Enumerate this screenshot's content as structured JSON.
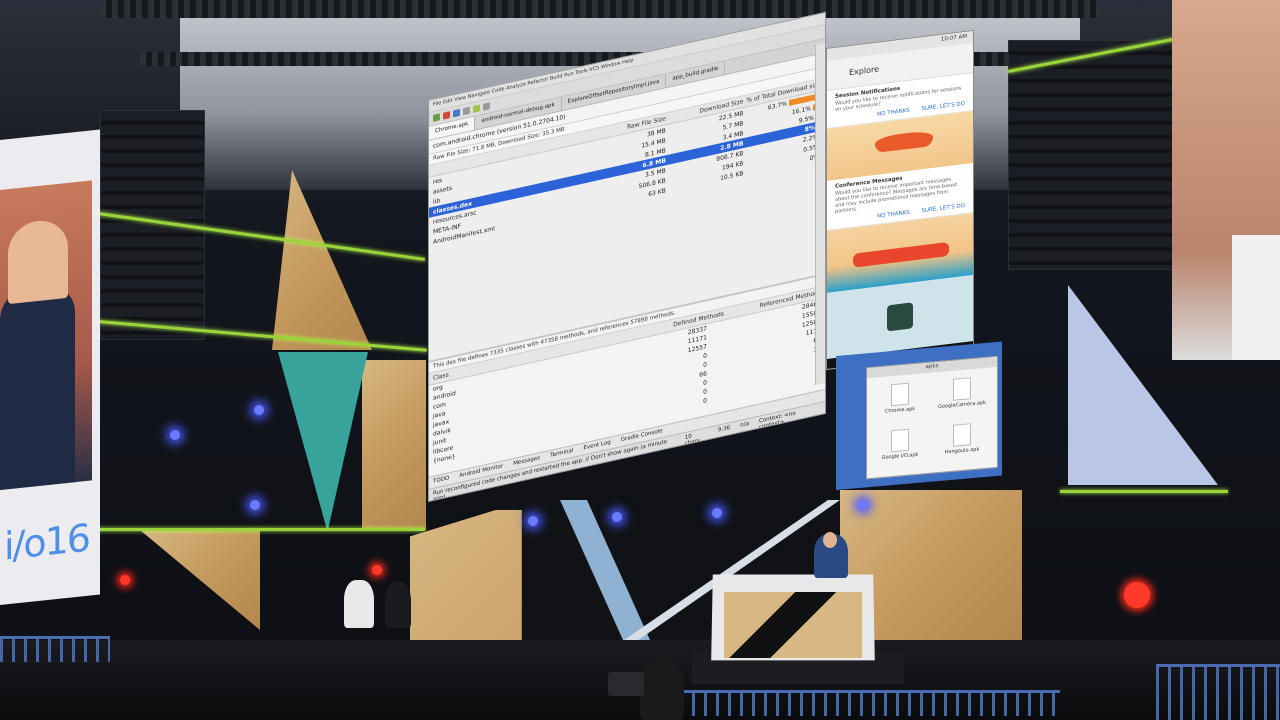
{
  "scene": {
    "description_label": "Keynote stage photo with projected Android Studio APK Analyzer"
  },
  "ide": {
    "menu": "File  Edit  View  Navigate  Code  Analyze  Refactor  Build  Run  Tools  VCS  Window  Help",
    "tabs": [
      "Chrome.apk",
      "android-normal-debug.apk",
      "ExploreOffsetRepositoryImpl.java",
      "app_build.gradle"
    ],
    "header_path": "com.android.chrome (version 51.0.2704.10)",
    "header_size": "Raw File Size: 71.8 MB, Download Size: 35.3 MB",
    "columns": {
      "file": "",
      "raw": "Raw File Size",
      "download": "Download Size",
      "percent": "% of Total Download size"
    },
    "files": [
      {
        "name": "res",
        "raw": "38 MB",
        "download": "22.5 MB",
        "percent": "63.7%",
        "bar": 64
      },
      {
        "name": "assets",
        "raw": "15.4 MB",
        "download": "5.7 MB",
        "percent": "16.1%",
        "bar": 16
      },
      {
        "name": "lib",
        "raw": "8.1 MB",
        "download": "3.4 MB",
        "percent": "9.5%",
        "bar": 10
      },
      {
        "name": "classes.dex",
        "raw": "6.8 MB",
        "download": "2.8 MB",
        "percent": "8%",
        "bar": 8
      },
      {
        "name": "resources.arsc",
        "raw": "3.5 MB",
        "download": "808.7 KB",
        "percent": "2.2%",
        "bar": 2
      },
      {
        "name": "META-INF",
        "raw": "506.8 KB",
        "download": "194 KB",
        "percent": "0.5%",
        "bar": 1
      },
      {
        "name": "AndroidManifest.xml",
        "raw": "63 KB",
        "download": "10.5 KB",
        "percent": "0%",
        "bar": 0
      }
    ],
    "dex_info": "This dex file defines 7335 classes with 47358 methods, and references 57898 methods.",
    "dex_columns": {
      "name": "Class",
      "defined": "Defined Methods",
      "referenced": "Referenced Methods"
    },
    "dex_rows": [
      {
        "name": "org",
        "defined": "28337",
        "referenced": "28467"
      },
      {
        "name": "android",
        "defined": "11171",
        "referenced": "15581"
      },
      {
        "name": "com",
        "defined": "12557",
        "referenced": "12567"
      },
      {
        "name": "java",
        "defined": "0",
        "referenced": "1175"
      },
      {
        "name": "javax",
        "defined": "0",
        "referenced": "66"
      },
      {
        "name": "dalvik",
        "defined": "66",
        "referenced": "32"
      },
      {
        "name": "junit",
        "defined": "0",
        "referenced": "3"
      },
      {
        "name": "libcore",
        "defined": "0",
        "referenced": "1"
      },
      {
        "name": "{none}",
        "defined": "0",
        "referenced": "1"
      }
    ],
    "bottombar": [
      "TODO",
      "Android Monitor",
      "Messages",
      "Terminal",
      "Event Log",
      "Gradle Console"
    ],
    "status": [
      "Run reconfigured code changes and restarted the app. // Don't show again (a minute ago)",
      "10 chars",
      "9:36",
      "n/a",
      "Context: <no context>"
    ],
    "side_labels": [
      "Gradle",
      "Android Model"
    ]
  },
  "phone": {
    "status_time": "10:07 AM",
    "app_title": "Explore",
    "card1_title": "Session Notifications",
    "card1_body": "Would you like to receive notifications for sessions on your schedule?",
    "card1_no": "NO THANKS",
    "card1_yes": "SURE, LET'S DO",
    "card2_title": "Conference Messages",
    "card2_body": "Would you like to receive important messages about the conference? Messages are time-based and may include promotional messages from partners.",
    "card2_no": "NO THANKS",
    "card2_yes": "SURE, LET'S DO",
    "nav_back": "◁",
    "nav_home": "○",
    "nav_recent": "□"
  },
  "file_window": {
    "title": "apks",
    "items": [
      "Chrome.apk",
      "GoogleCamera.apk",
      "Google I/O.apk",
      "Hangouts.apk"
    ]
  },
  "colors": {
    "selection": "#2d63d8",
    "bar": "#f08a26",
    "accent_green": "#9ad43a",
    "io_blue": "#4f8fe6"
  },
  "left_screen_logo": "i/o16"
}
